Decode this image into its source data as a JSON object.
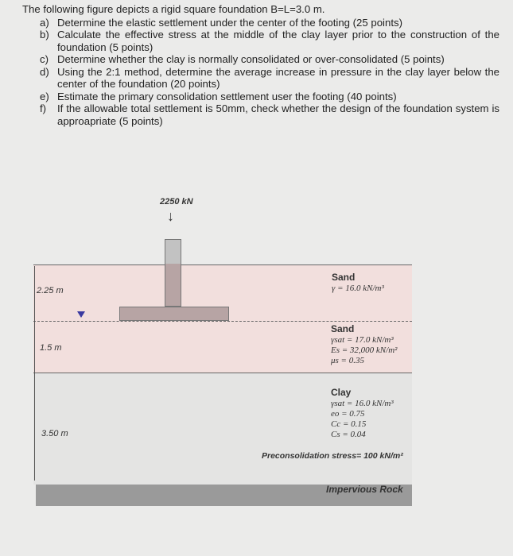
{
  "question": {
    "intro": "The following figure depicts a rigid square foundation B=L=3.0 m.",
    "items": [
      {
        "key": "a)",
        "text": "Determine the elastic settlement under the center of the footing (25 points)"
      },
      {
        "key": "b)",
        "text": "Calculate the effective stress at the middle of the clay layer prior to the construction of the foundation (5 points)"
      },
      {
        "key": "c)",
        "text": "Determine whether the clay is normally consolidated or over-consolidated (5 points)"
      },
      {
        "key": "d)",
        "text": "Using the 2:1 method, determine the average increase in pressure in the clay layer below the center of the foundation (20 points)"
      },
      {
        "key": "e)",
        "text": "Estimate the primary consolidation settlement user the footing (40 points)"
      },
      {
        "key": "f)",
        "text": "If the allowable total settlement is 50mm, check whether the design of the foundation system is approapriate (5 points)"
      }
    ]
  },
  "figure": {
    "load": "2250 kN",
    "dims": [
      "2.25 m",
      "1.5 m",
      "3.50 m"
    ],
    "layer1": {
      "name": "Sand",
      "props": [
        "γ = 16.0 kN/m³"
      ]
    },
    "layer2": {
      "name": "Sand",
      "props": [
        "γsat = 17.0 kN/m³",
        "Es = 32,000 kN/m²",
        "μs = 0.35"
      ]
    },
    "layer3": {
      "name": "Clay",
      "props": [
        "γsat = 16.0 kN/m³",
        "eo = 0.75",
        "Cc = 0.15",
        "Cs = 0.04"
      ],
      "note": "Preconsolidation stress= 100 kN/m²"
    },
    "rock": "Impervious Rock",
    "colors": {
      "sand": "#f2dfdd",
      "clay": "#e4e4e3",
      "rock": "#9a9a9a",
      "footing": "#b7a4a4",
      "water_table": "#3a3aa0"
    }
  }
}
